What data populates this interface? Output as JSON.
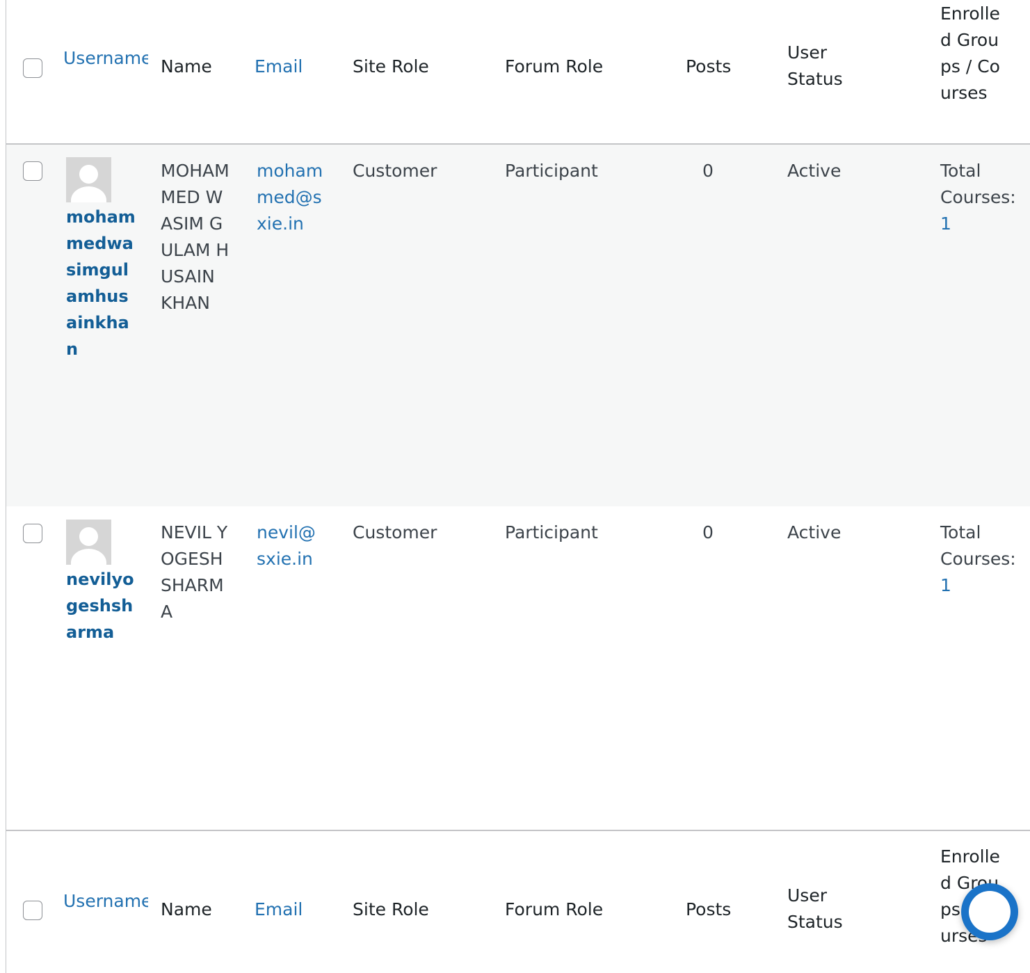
{
  "table": {
    "columns": {
      "username": "Username",
      "name": "Name",
      "email": "Email",
      "site_role": "Site Role",
      "forum_role": "Forum Role",
      "posts": "Posts",
      "user_status": "User Status",
      "enrolled": "Enrolled Groups / Courses"
    },
    "rows": [
      {
        "username": "mohammedwasimgulamhusainkhan",
        "name": "MOHAMMED WASIM GULAM HUSAIN KHAN",
        "email": "mohammed@sxie.in",
        "site_role": "Customer",
        "forum_role": "Participant",
        "posts": "0",
        "status": "Active",
        "courses_label": "Total Courses:",
        "courses_count": "1"
      },
      {
        "username": "nevilyogeshsharma",
        "name": "NEVIL YOGESH SHARMA",
        "email": "nevil@sxie.in",
        "site_role": "Customer",
        "forum_role": "Participant",
        "posts": "0",
        "status": "Active",
        "courses_label": "Total Courses:",
        "courses_count": "1"
      }
    ]
  },
  "icons": {
    "avatar": "default-avatar-icon",
    "chat": "chat-bubble-icon"
  },
  "colors": {
    "link": "#2271b1",
    "username_link": "#135e96",
    "row_alt_bg": "#f6f7f7",
    "border": "#c3c4c7",
    "chat_accent": "#1a73c8"
  }
}
